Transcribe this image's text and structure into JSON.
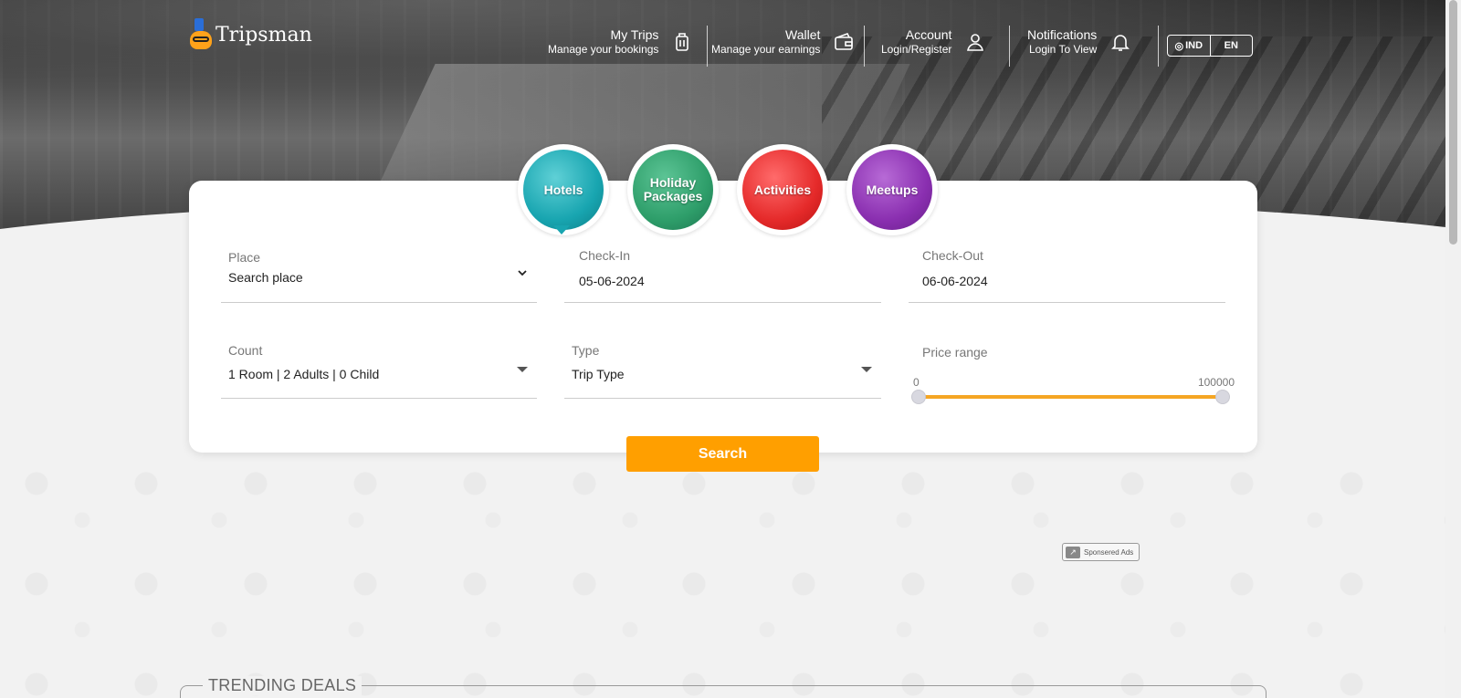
{
  "brand": {
    "name": "Tripsman"
  },
  "nav": [
    {
      "title": "My Trips",
      "subtitle": "Manage your bookings",
      "icon": "luggage-icon"
    },
    {
      "title": "Wallet",
      "subtitle": "Manage your earnings",
      "icon": "wallet-icon"
    },
    {
      "title": "Account",
      "subtitle": "Login/Register",
      "icon": "user-icon"
    },
    {
      "title": "Notifications",
      "subtitle": "Login To View",
      "icon": "bell-icon"
    }
  ],
  "lang": {
    "country": "IND",
    "language": "EN",
    "globe_icon": "globe-icon"
  },
  "categories": [
    {
      "label": "Hotels",
      "color": "#18a5b0",
      "active": true
    },
    {
      "label": "Holiday Packages",
      "color": "#2e9e6a",
      "active": false
    },
    {
      "label": "Activities",
      "color": "#e52a2a",
      "active": false
    },
    {
      "label": "Meetups",
      "color": "#8a2fb0",
      "active": false
    }
  ],
  "form": {
    "place": {
      "label": "Place",
      "value": "Search place",
      "icon": "chevron-down-icon"
    },
    "checkin": {
      "label": "Check-In",
      "value": "05-06-2024"
    },
    "checkout": {
      "label": "Check-Out",
      "value": "06-06-2024"
    },
    "count": {
      "label": "Count",
      "value": "1 Room | 2 Adults | 0 Child"
    },
    "type": {
      "label": "Type",
      "value": "Trip Type"
    },
    "price": {
      "label": "Price range",
      "min": "0",
      "max": "100000"
    },
    "search_label": "Search"
  },
  "ads": {
    "label": "Sponsered Ads"
  },
  "sections": {
    "trending": "TRENDING DEALS"
  },
  "colors": {
    "accent": "#ff9f00",
    "slider": "#f5a623"
  }
}
